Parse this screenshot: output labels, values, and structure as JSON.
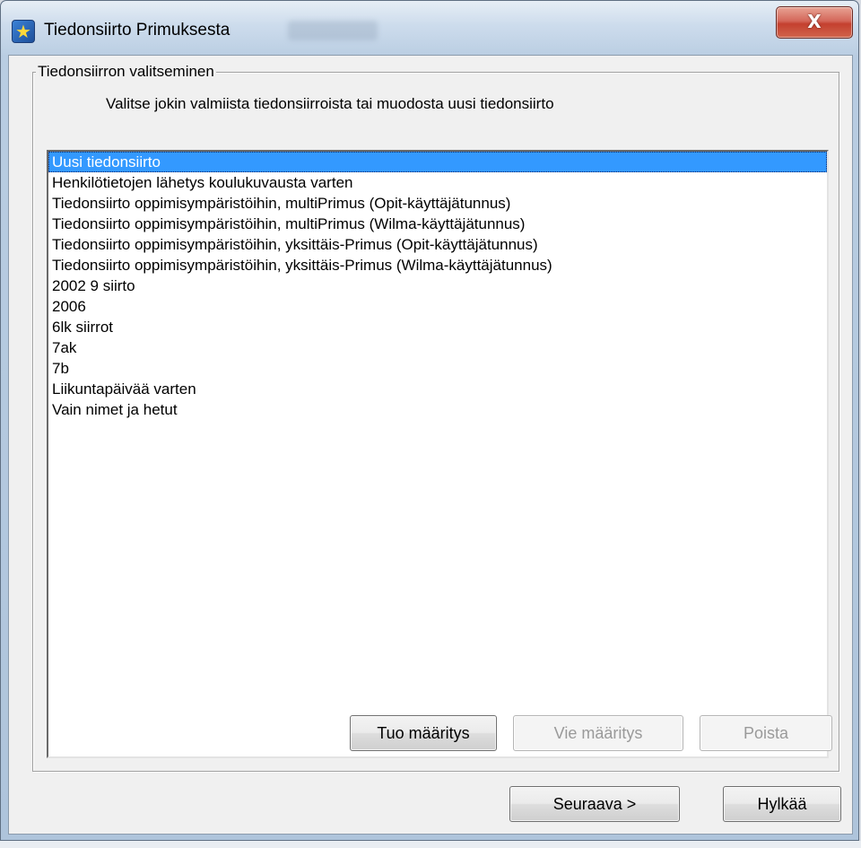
{
  "window": {
    "title": "Tiedonsiirto Primuksesta",
    "close_label": "X"
  },
  "group": {
    "legend": "Tiedonsiirron valitseminen",
    "instruction": "Valitse jokin valmiista tiedonsiirroista tai muodosta uusi tiedonsiirto"
  },
  "list": {
    "selected_index": 0,
    "items": [
      "Uusi tiedonsiirto",
      "Henkilötietojen lähetys koulukuvausta varten",
      "Tiedonsiirto oppimisympäristöihin, multiPrimus (Opit-käyttäjätunnus)",
      "Tiedonsiirto oppimisympäristöihin, multiPrimus (Wilma-käyttäjätunnus)",
      "Tiedonsiirto oppimisympäristöihin, yksittäis-Primus (Opit-käyttäjätunnus)",
      "Tiedonsiirto oppimisympäristöihin, yksittäis-Primus (Wilma-käyttäjätunnus)",
      "2002 9 siirto",
      "2006",
      "6lk siirrot",
      "7ak",
      "7b",
      "Liikuntapäivää varten",
      "Vain nimet ja hetut"
    ]
  },
  "buttons": {
    "import": "Tuo määritys",
    "export": "Vie määritys",
    "delete": "Poista",
    "next": "Seuraava >",
    "cancel": "Hylkää"
  },
  "colors": {
    "selection": "#3399ff",
    "close_button": "#c4402f"
  },
  "icons": {
    "app": "star-icon",
    "close": "close-icon"
  }
}
